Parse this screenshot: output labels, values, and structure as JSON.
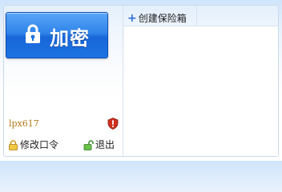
{
  "encrypt_button": {
    "label": "加密",
    "icon": "lock-icon"
  },
  "toolbar": {
    "create_box_label": "创建保险箱",
    "create_box_icon": "plus-icon"
  },
  "user": {
    "username": "lpx617",
    "status_icon": "shield-icon"
  },
  "actions": {
    "change_password_label": "修改口令",
    "change_password_icon": "padlock-icon",
    "logout_label": "退出",
    "logout_icon": "unlock-icon"
  },
  "colors": {
    "button_blue": "#1d73e2",
    "username_gold": "#b07c1a",
    "shield_red": "#d0301f"
  }
}
